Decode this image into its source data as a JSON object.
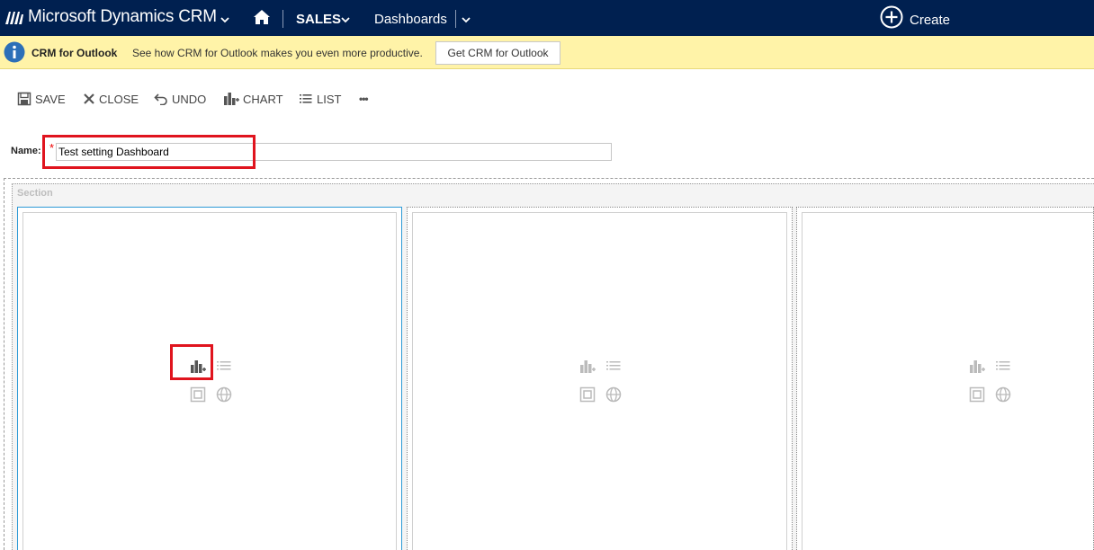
{
  "nav": {
    "app_title": "Microsoft Dynamics CRM",
    "area": "SALES",
    "section": "Dashboards",
    "create_label": "Create",
    "colors": {
      "nav_bg": "#002050",
      "notif_bg": "#fff3a8",
      "highlight": "#e0141e",
      "selected_border": "#2d9ad6"
    }
  },
  "notification": {
    "title": "CRM for Outlook",
    "message": "See how CRM for Outlook makes you even more productive.",
    "button_label": "Get CRM for Outlook"
  },
  "commands": {
    "save": "SAVE",
    "close": "CLOSE",
    "undo": "UNDO",
    "chart": "CHART",
    "list": "LIST",
    "more": "•••"
  },
  "form": {
    "name_label": "Name:",
    "required_mark": "*",
    "name_value": "Test setting Dashboard"
  },
  "layout": {
    "section_title": "Section",
    "components": [
      {
        "id": "component-1",
        "selected": true,
        "icons": [
          "insert-chart-icon",
          "insert-list-icon",
          "insert-iframe-icon",
          "insert-web-resource-icon"
        ]
      },
      {
        "id": "component-2",
        "selected": false,
        "icons": [
          "insert-chart-icon",
          "insert-list-icon",
          "insert-iframe-icon",
          "insert-web-resource-icon"
        ]
      },
      {
        "id": "component-3",
        "selected": false,
        "icons": [
          "insert-chart-icon",
          "insert-list-icon",
          "insert-iframe-icon",
          "insert-web-resource-icon"
        ]
      }
    ]
  }
}
